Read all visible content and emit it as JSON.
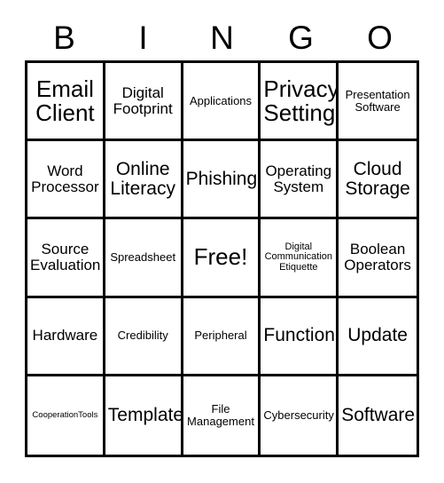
{
  "card": {
    "title": "BINGO",
    "free_space_label": "Free!",
    "border_color": "#000000",
    "background_color": "#ffffff",
    "text_color": "#000000"
  },
  "header": {
    "letters": [
      "B",
      "I",
      "N",
      "G",
      "O"
    ]
  },
  "grid": {
    "columns": 5,
    "rows": 5,
    "cells": [
      {
        "label": "Email Client",
        "size": "sz-xl",
        "free": false
      },
      {
        "label": "Digital Footprint",
        "size": "sz-md",
        "free": false
      },
      {
        "label": "Applications",
        "size": "sz-sm",
        "free": false
      },
      {
        "label": "Privacy Settings",
        "size": "sz-xl",
        "free": false
      },
      {
        "label": "Presentation Software",
        "size": "sz-sm",
        "free": false
      },
      {
        "label": "Word Processor",
        "size": "sz-md",
        "free": false
      },
      {
        "label": "Online Literacy",
        "size": "sz-lg",
        "free": false
      },
      {
        "label": "Phishing",
        "size": "sz-lg",
        "free": false
      },
      {
        "label": "Operating System",
        "size": "sz-md",
        "free": false
      },
      {
        "label": "Cloud Storage",
        "size": "sz-lg",
        "free": false
      },
      {
        "label": "Source Evaluation",
        "size": "sz-md",
        "free": false
      },
      {
        "label": "Spreadsheet",
        "size": "sz-sm",
        "free": false
      },
      {
        "label": "Free!",
        "size": "sz-xl",
        "free": true
      },
      {
        "label": "Digital Communication Etiquette",
        "size": "sz-xs",
        "free": false
      },
      {
        "label": "Boolean Operators",
        "size": "sz-md",
        "free": false
      },
      {
        "label": "Hardware",
        "size": "sz-md",
        "free": false
      },
      {
        "label": "Credibility",
        "size": "sz-sm",
        "free": false
      },
      {
        "label": "Peripheral",
        "size": "sz-sm",
        "free": false
      },
      {
        "label": "Function",
        "size": "sz-lg",
        "free": false
      },
      {
        "label": "Update",
        "size": "sz-lg",
        "free": false
      },
      {
        "label": "CooperationTools",
        "size": "sz-xxs",
        "free": false
      },
      {
        "label": "Template",
        "size": "sz-lg",
        "free": false
      },
      {
        "label": "File Management",
        "size": "sz-sm",
        "free": false
      },
      {
        "label": "Cybersecurity",
        "size": "sz-sm",
        "free": false
      },
      {
        "label": "Software",
        "size": "sz-lg",
        "free": false
      }
    ]
  }
}
